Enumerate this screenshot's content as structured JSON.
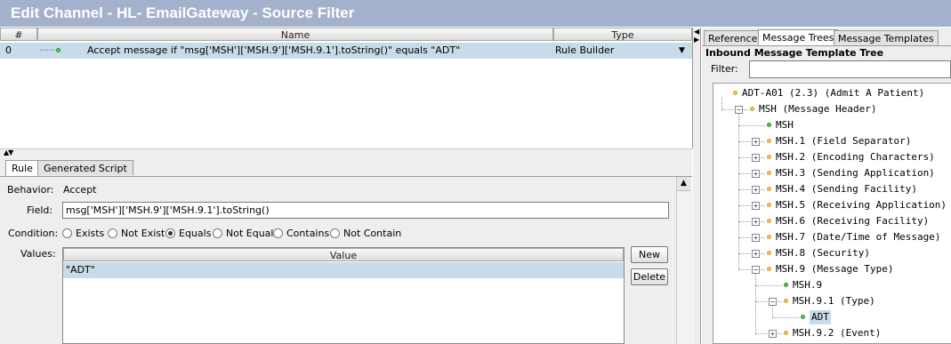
{
  "window": {
    "title": "Edit Channel - HL- EmailGateway - Source Filter"
  },
  "rules_table": {
    "columns": [
      "#",
      "Name",
      "Type"
    ],
    "rows": [
      {
        "num": "0",
        "name": "Accept message if \"msg['MSH']['MSH.9']['MSH.9.1'].toString()\" equals \"ADT\"",
        "type": "Rule Builder"
      }
    ]
  },
  "editor": {
    "tabs": [
      "Rule",
      "Generated Script"
    ],
    "behavior_label": "Behavior:",
    "behavior_value": "Accept",
    "field_label": "Field:",
    "field_value": "msg['MSH']['MSH.9']['MSH.9.1'].toString()",
    "condition_label": "Condition:",
    "conditions": [
      "Exists",
      "Not Exist",
      "Equals",
      "Not Equal",
      "Contains",
      "Not Contain"
    ],
    "selected_condition": "Equals",
    "values_label": "Values:",
    "values_header": "Value",
    "values": [
      "\"ADT\""
    ],
    "new_button": "New",
    "delete_button": "Delete"
  },
  "right_panel": {
    "tabs": [
      "Reference",
      "Message Trees",
      "Message Templates"
    ],
    "active_tab": "Message Trees",
    "tree_title": "Inbound Message Template Tree",
    "filter_label": "Filter:",
    "filter_value": "",
    "tree": [
      {
        "label": "ADT-A01 (2.3) (Admit A Patient)",
        "level": 0,
        "expander": "none",
        "icon": "yellow"
      },
      {
        "label": "MSH (Message Header)",
        "level": 1,
        "expander": "minus",
        "icon": "yellow"
      },
      {
        "label": "MSH",
        "level": 2,
        "expander": "none",
        "icon": "green"
      },
      {
        "label": "MSH.1 (Field Separator)",
        "level": 2,
        "expander": "plus",
        "icon": "yellow"
      },
      {
        "label": "MSH.2 (Encoding Characters)",
        "level": 2,
        "expander": "plus",
        "icon": "yellow"
      },
      {
        "label": "MSH.3 (Sending Application)",
        "level": 2,
        "expander": "plus",
        "icon": "yellow"
      },
      {
        "label": "MSH.4 (Sending Facility)",
        "level": 2,
        "expander": "plus",
        "icon": "yellow"
      },
      {
        "label": "MSH.5 (Receiving Application)",
        "level": 2,
        "expander": "plus",
        "icon": "yellow"
      },
      {
        "label": "MSH.6 (Receiving Facility)",
        "level": 2,
        "expander": "plus",
        "icon": "yellow"
      },
      {
        "label": "MSH.7 (Date/Time of Message)",
        "level": 2,
        "expander": "plus",
        "icon": "yellow"
      },
      {
        "label": "MSH.8 (Security)",
        "level": 2,
        "expander": "plus",
        "icon": "yellow"
      },
      {
        "label": "MSH.9 (Message Type)",
        "level": 2,
        "expander": "minus",
        "icon": "yellow"
      },
      {
        "label": "MSH.9",
        "level": 3,
        "expander": "none",
        "icon": "green"
      },
      {
        "label": "MSH.9.1 (Type)",
        "level": 3,
        "expander": "minus",
        "icon": "yellow"
      },
      {
        "label": "ADT",
        "level": 4,
        "expander": "none",
        "icon": "green",
        "selected": true
      },
      {
        "label": "MSH.9.2 (Event)",
        "level": 3,
        "expander": "plus",
        "icon": "yellow"
      }
    ]
  },
  "colors": {
    "title_bar": "#a3b1cc",
    "selection": "#c7dbe8"
  },
  "icons": [
    "rule-node-icon",
    "radio-button-icon",
    "tree-node-icon",
    "expand-icon",
    "collapse-icon",
    "scroll-up-icon",
    "dropdown-arrow-icon",
    "split-arrow-icon"
  ]
}
